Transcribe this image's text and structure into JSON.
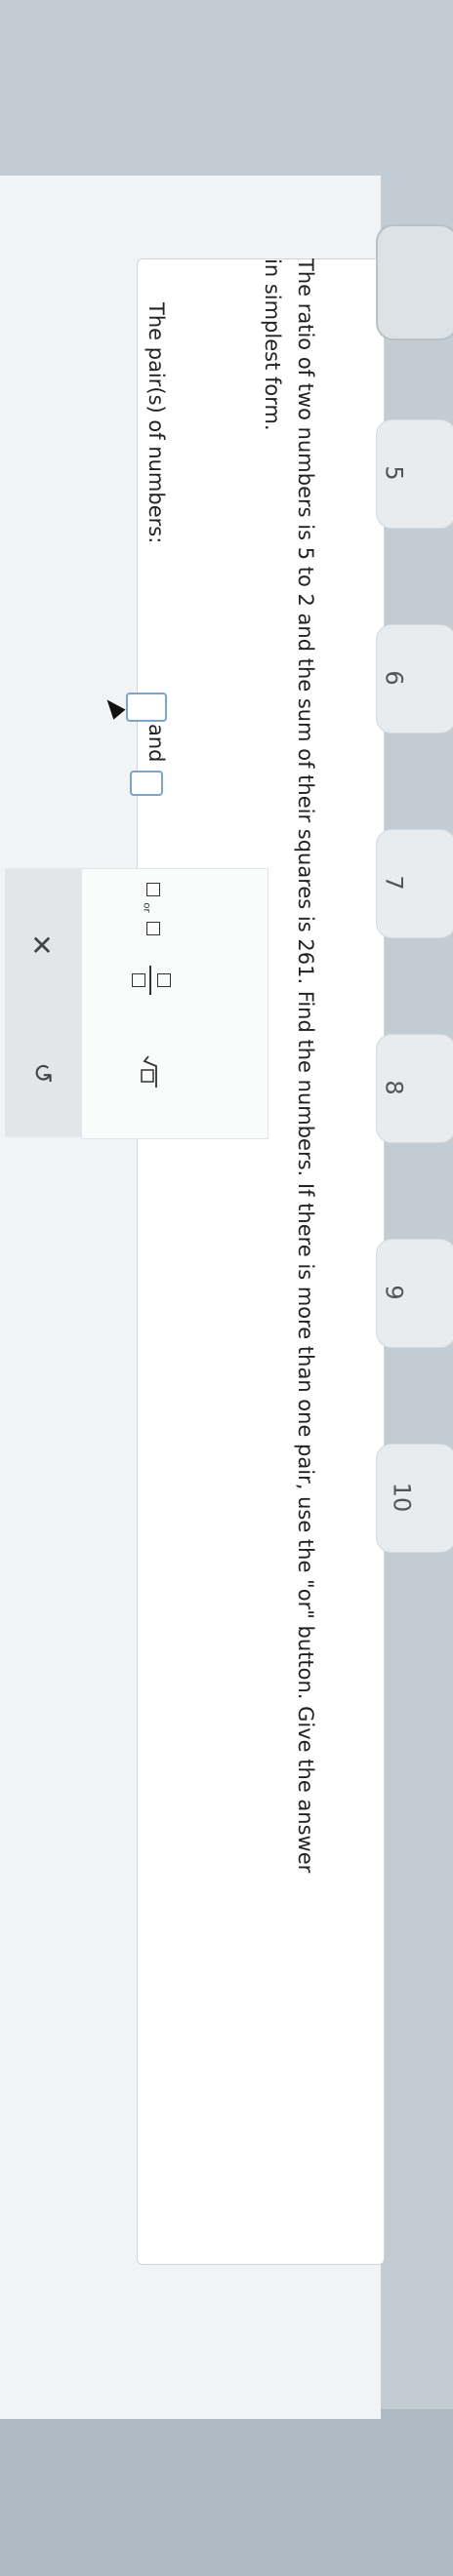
{
  "question": {
    "line1": "The ratio of two numbers is 5 to 2 and the sum of their squares is 261. Find the numbers. If there is more than one pair, use the \"or\" button. Give the answer",
    "line2": "in simplest form."
  },
  "answer": {
    "label": "The pair(s) of numbers:",
    "connector": "and"
  },
  "toolbar": {
    "or_label": "or",
    "clear_symbol": "✕",
    "undo_symbol": "↺"
  },
  "tabs": [
    "5",
    "6",
    "7",
    "8",
    "9",
    "10"
  ]
}
